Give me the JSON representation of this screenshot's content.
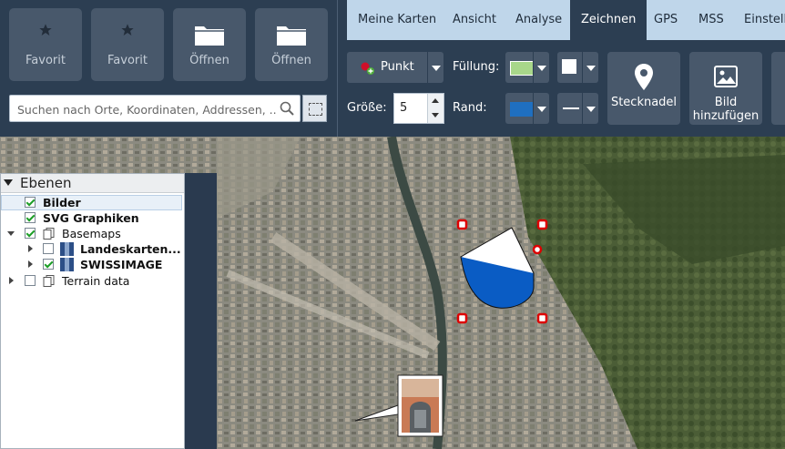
{
  "favorites": [
    {
      "label": "Favorit",
      "icon": "star-icon"
    },
    {
      "label": "Favorit",
      "icon": "star-icon"
    },
    {
      "label": "Öffnen",
      "icon": "folder-icon"
    },
    {
      "label": "Öffnen",
      "icon": "folder-icon"
    }
  ],
  "search": {
    "placeholder": "Suchen nach Orte, Koordinaten, Addressen, ..."
  },
  "tabs": [
    {
      "label": "Meine Karten"
    },
    {
      "label": "Ansicht"
    },
    {
      "label": "Analyse"
    },
    {
      "label": "Zeichnen",
      "active": true
    },
    {
      "label": "GPS"
    },
    {
      "label": "MSS"
    },
    {
      "label": "Einstell"
    }
  ],
  "draw": {
    "type_label": "Punkt",
    "fill_label": "Füllung:",
    "border_label": "Rand:",
    "size_label": "Größe:",
    "size_value": "5",
    "fill_color": "#a8d78a",
    "border_color": "#1f6fc0",
    "pin_label": "Stecknadel",
    "image_label_1": "Bild",
    "image_label_2": "hinzufügen"
  },
  "layers": {
    "title": "Ebenen",
    "items": [
      {
        "label": "Bilder",
        "checked": true
      },
      {
        "label": "SVG Graphiken",
        "checked": true
      },
      {
        "label": "Basemaps",
        "checked": true
      },
      {
        "label": "Landeskarten...",
        "checked": false
      },
      {
        "label": "SWISSIMAGE",
        "checked": true
      },
      {
        "label": "Terrain data",
        "checked": false
      }
    ]
  },
  "colors": {
    "accent": "#2c3e52",
    "tab_bg": "#bfd6ea",
    "button": "#48586b"
  }
}
